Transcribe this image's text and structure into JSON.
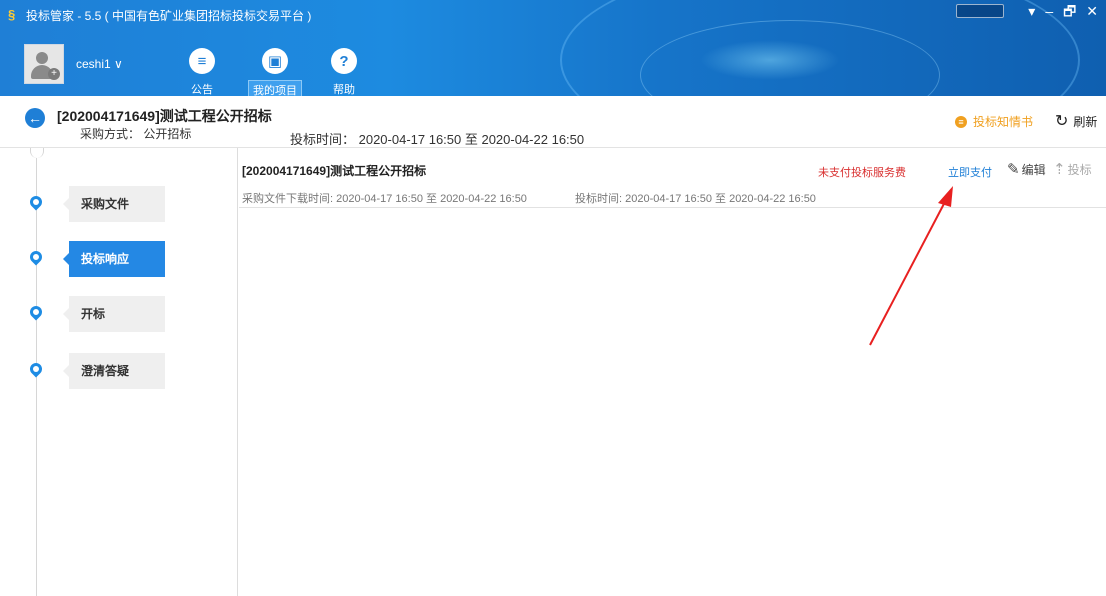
{
  "window": {
    "title": "投标管家 - 5.5 ( 中国有色矿业集团招标投标交易平台 )",
    "controls": [
      "▾",
      "–",
      "🗗",
      "✕"
    ]
  },
  "user": {
    "name": "ceshi1 ∨"
  },
  "nav": [
    {
      "label": "公告",
      "icon": "list-icon",
      "glyph": "≡"
    },
    {
      "label": "我的项目",
      "icon": "briefcase-icon",
      "glyph": "▣",
      "active": true
    },
    {
      "label": "帮助",
      "icon": "help-icon",
      "glyph": "?"
    }
  ],
  "project": {
    "title": "[202004171649]测试工程公开招标",
    "method": "采购方式： 公开招标",
    "bid_time": "投标时间： 2020-04-17 16:50 至 2020-04-22 16:50",
    "notice_label": "投标知情书",
    "refresh_label": "刷新"
  },
  "steps": [
    {
      "label": "采购文件"
    },
    {
      "label": "投标响应",
      "active": true
    },
    {
      "label": "开标"
    },
    {
      "label": "澄清答疑"
    }
  ],
  "item": {
    "title": "[202004171649]测试工程公开招标",
    "download_time": "采购文件下载时间: 2020-04-17 16:50 至 2020-04-22 16:50",
    "bid_time": "投标时间: 2020-04-17 16:50 至 2020-04-22 16:50",
    "status": "未支付投标服务费",
    "pay_label": "立即支付",
    "edit_label": "编辑",
    "bid_label": "投标"
  },
  "colors": {
    "brand": "#1f7fd6",
    "status_red": "#d93030",
    "notice_orange": "#f0a020",
    "arrow": "#e82020"
  }
}
